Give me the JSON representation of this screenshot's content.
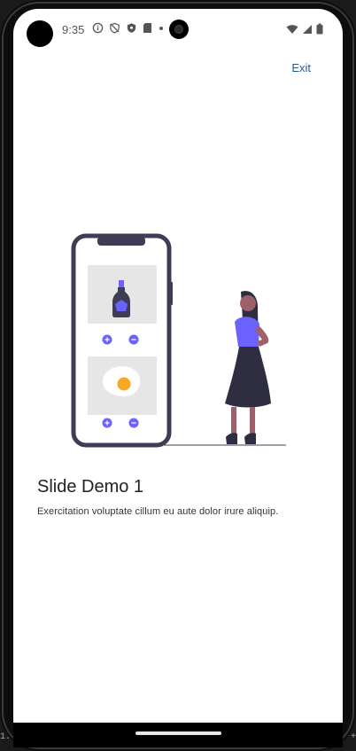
{
  "status_bar": {
    "time": "9:35",
    "left_icons": [
      "info-icon",
      "shield-off-icon",
      "shield-icon",
      "sd-card-icon",
      "dot-icon"
    ],
    "right_icons": [
      "wifi-icon",
      "signal-icon",
      "battery-icon"
    ]
  },
  "header": {
    "exit_label": "Exit"
  },
  "slide": {
    "title": "Slide Demo 1",
    "description": "Exercitation voluptate cillum eu aute dolor irure aliquip.",
    "illustration": "woman-phone-shopping-illustration"
  },
  "colors": {
    "accent": "#6c63ff",
    "dark": "#3f3d56",
    "exit_link": "#2a5a8a",
    "egg_yolk": "#f9a825"
  },
  "edge_marks": {
    "left": "1.",
    "right": "+"
  }
}
